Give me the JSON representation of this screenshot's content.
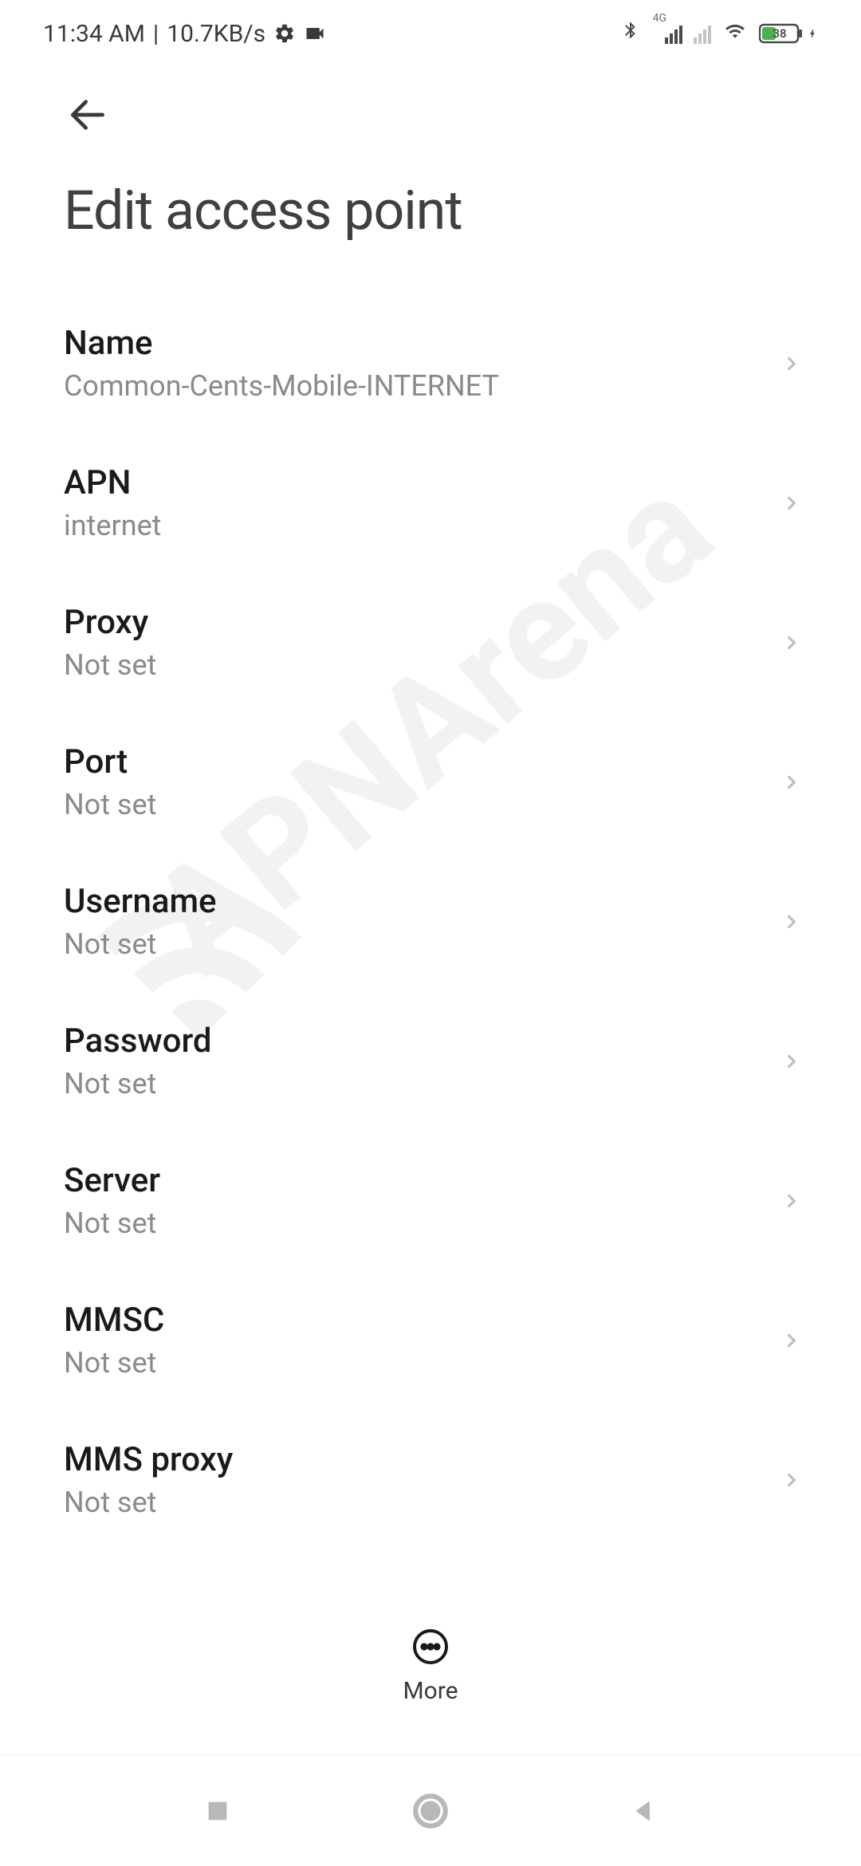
{
  "status": {
    "time": "11:34 AM",
    "separator": "|",
    "net_speed": "10.7KB/s",
    "battery_level": "38",
    "network_label": "4G"
  },
  "header": {
    "title": "Edit access point"
  },
  "settings": [
    {
      "label": "Name",
      "value": "Common-Cents-Mobile-INTERNET"
    },
    {
      "label": "APN",
      "value": "internet"
    },
    {
      "label": "Proxy",
      "value": "Not set"
    },
    {
      "label": "Port",
      "value": "Not set"
    },
    {
      "label": "Username",
      "value": "Not set"
    },
    {
      "label": "Password",
      "value": "Not set"
    },
    {
      "label": "Server",
      "value": "Not set"
    },
    {
      "label": "MMSC",
      "value": "Not set"
    },
    {
      "label": "MMS proxy",
      "value": "Not set"
    }
  ],
  "footer": {
    "more_label": "More"
  },
  "watermark": "APNArena"
}
